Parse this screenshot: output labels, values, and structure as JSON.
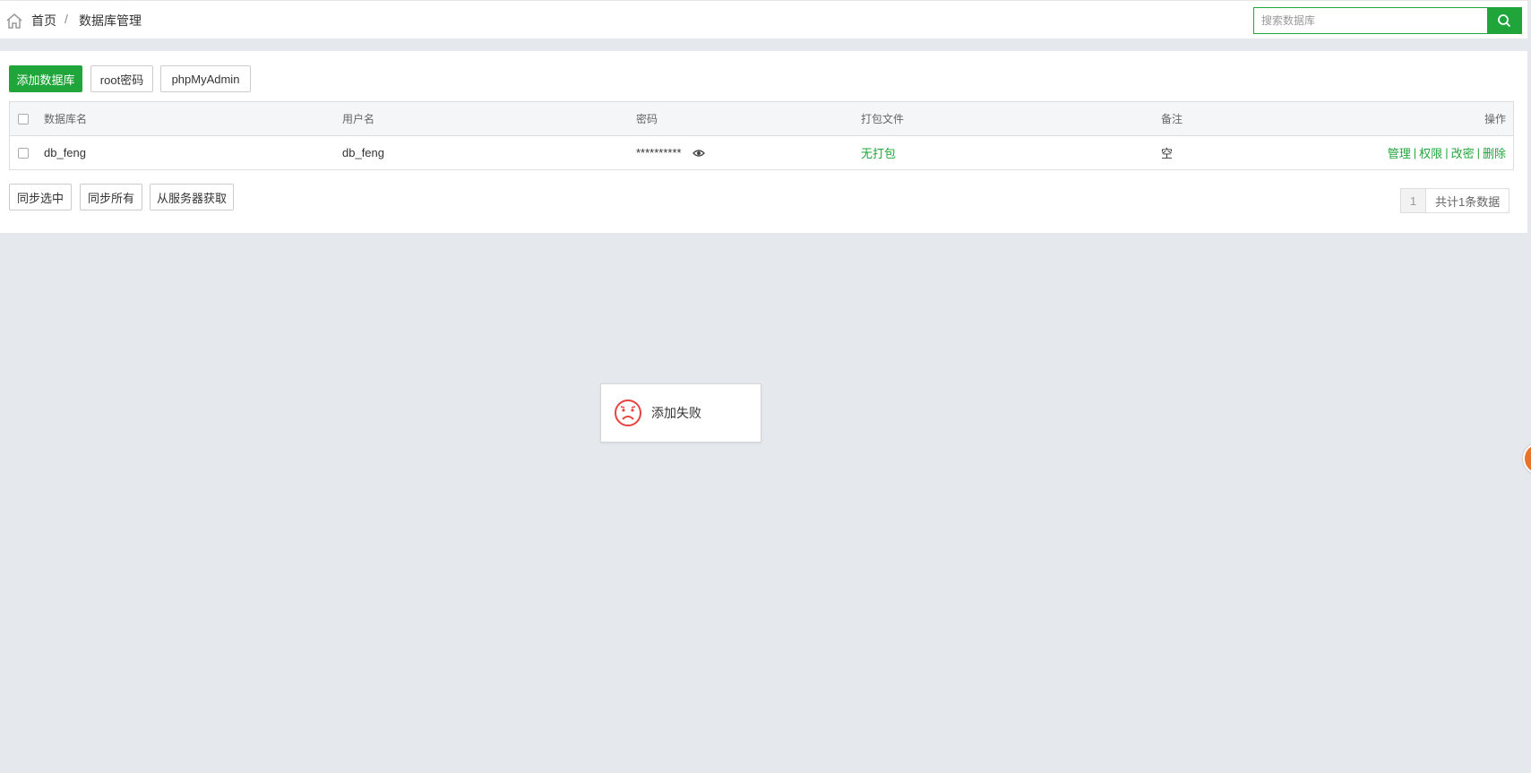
{
  "breadcrumb": {
    "home": "首页",
    "separator": "/",
    "current": "数据库管理"
  },
  "search": {
    "placeholder": "搜索数据库",
    "value": ""
  },
  "toolbar": {
    "add_db": "添加数据库",
    "root_password": "root密码",
    "phpmyadmin": "phpMyAdmin"
  },
  "table": {
    "headers": {
      "name": "数据库名",
      "username": "用户名",
      "password": "密码",
      "backup": "打包文件",
      "remark": "备注",
      "actions": "操作"
    },
    "rows": [
      {
        "name": "db_feng",
        "username": "db_feng",
        "password": "**********",
        "backup": "无打包",
        "remark": "空",
        "actions": [
          "管理",
          "权限",
          "改密",
          "删除"
        ]
      }
    ]
  },
  "bottom_actions": {
    "sync_selected": "同步选中",
    "sync_all": "同步所有",
    "fetch_server": "从服务器获取"
  },
  "pagination": {
    "current_page": "1",
    "total": "共计1条数据"
  },
  "toast": {
    "message": "添加失败",
    "icon": "sad-face-icon"
  },
  "colors": {
    "accent": "#20a53a",
    "error": "#e64340",
    "background": "#e5e8ec"
  }
}
